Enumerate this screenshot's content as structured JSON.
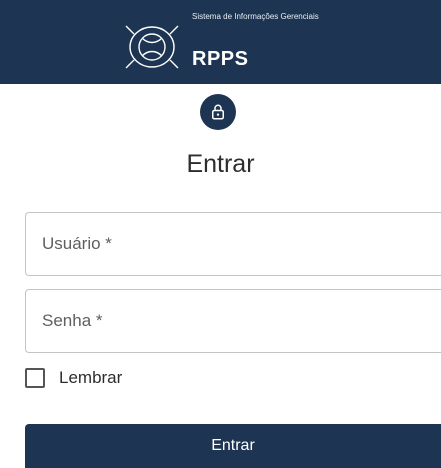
{
  "header": {
    "system_line": "Sistema de Informações Gerenciais",
    "brand": "RPPS",
    "logo_icon": "globe-emblem-icon"
  },
  "login": {
    "lock_icon": "lock-icon",
    "title": "Entrar",
    "username_label": "Usuário *",
    "password_label": "Senha *",
    "remember_label": "Lembrar",
    "remember_checked": false,
    "submit_label": "Entrar"
  },
  "colors": {
    "primary": "#1d3552",
    "border": "#c4c4c4",
    "text": "#2d2d2d"
  }
}
